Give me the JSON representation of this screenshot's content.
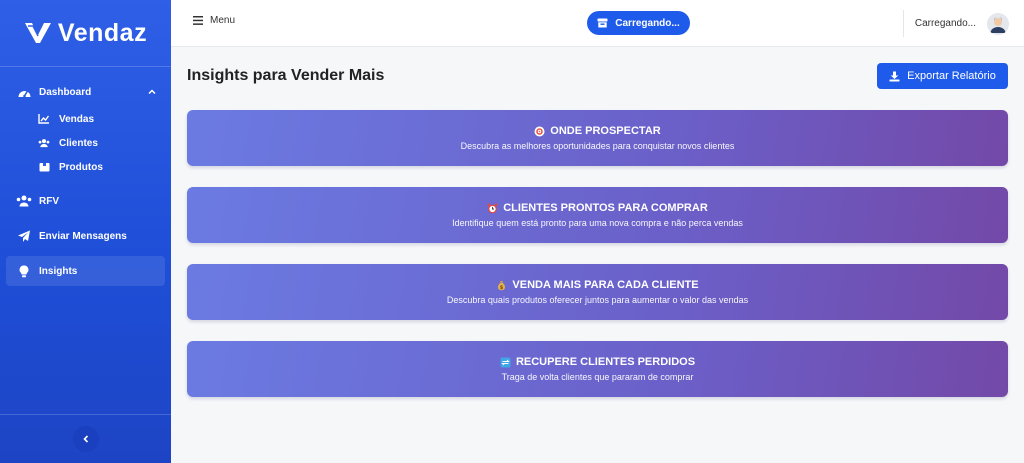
{
  "brand": {
    "name": "Vendaz"
  },
  "sidebar": {
    "items": [
      {
        "label": "Dashboard",
        "icon": "gauge-icon"
      },
      {
        "label": "RFV",
        "icon": "users-cog-icon"
      },
      {
        "label": "Enviar Mensagens",
        "icon": "paper-plane-icon"
      },
      {
        "label": "Insights",
        "icon": "lightbulb-icon"
      }
    ],
    "sub_items": [
      {
        "label": "Vendas",
        "icon": "chart-line-icon"
      },
      {
        "label": "Clientes",
        "icon": "users-icon"
      },
      {
        "label": "Produtos",
        "icon": "box-icon"
      }
    ]
  },
  "topbar": {
    "menu_label": "Menu",
    "store_label": "Carregando...",
    "user_label": "Carregando..."
  },
  "main": {
    "title": "Insights para Vender Mais",
    "export_label": "Exportar Relatório",
    "cards": [
      {
        "title": "ONDE PROSPECTAR",
        "desc": "Descubra as melhores oportunidades para conquistar novos clientes",
        "icon": "target-icon"
      },
      {
        "title": "CLIENTES PRONTOS PARA COMPRAR",
        "desc": "Identifique quem está pronto para uma nova compra e não perca vendas",
        "icon": "alarm-clock-icon"
      },
      {
        "title": "VENDA MAIS PARA CADA CLIENTE",
        "desc": "Descubra quais produtos oferecer juntos para aumentar o valor das vendas",
        "icon": "money-bag-icon"
      },
      {
        "title": "RECUPERE CLIENTES PERDIDOS",
        "desc": "Traga de volta clientes que pararam de comprar",
        "icon": "reload-icon"
      }
    ]
  },
  "colors": {
    "accent": "#1f5bea",
    "sidebar": "#2f5fe6",
    "card_start": "#6b7be2",
    "card_end": "#7349a8"
  }
}
